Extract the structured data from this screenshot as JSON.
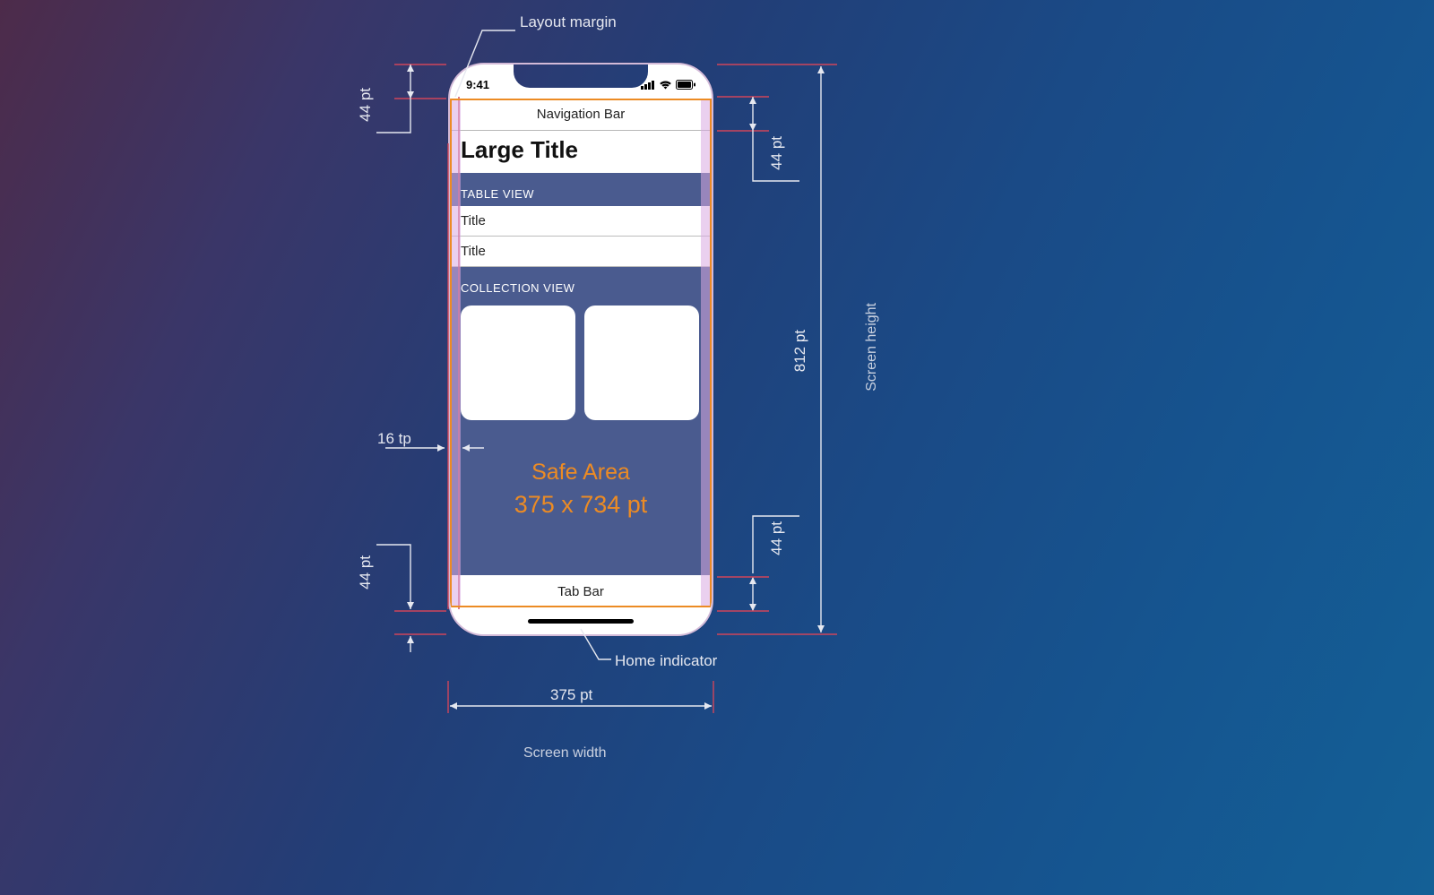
{
  "labels": {
    "layout_margin": "Layout margin",
    "home_indicator": "Home indicator",
    "screen_width": "Screen width",
    "screen_height": "Screen height",
    "width_value": "375 pt",
    "height_value": "812 pt",
    "left_margin_value": "16 tp",
    "status_height": "44 pt",
    "navbar_height": "44 pt",
    "tabbar_height": "44 pt",
    "home_ind_height": "44 pt",
    "safe_line1": "Safe Area",
    "safe_line2": "375 x 734 pt"
  },
  "status": {
    "time": "9:41"
  },
  "navbar": {
    "title": "Navigation Bar"
  },
  "large_title": "Large Title",
  "table": {
    "header": "TABLE VIEW",
    "rows": [
      "Title",
      "Title"
    ]
  },
  "collection": {
    "header": "COLLECTION VIEW"
  },
  "tabbar": {
    "title": "Tab Bar"
  }
}
